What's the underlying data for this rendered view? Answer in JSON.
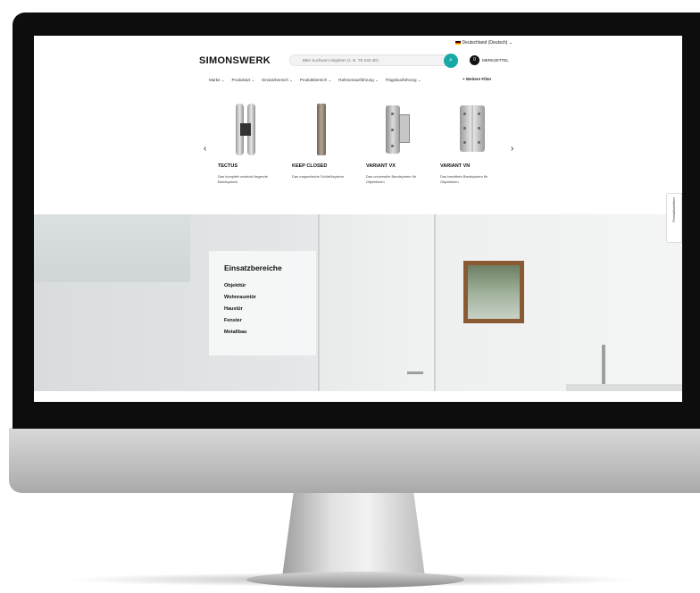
{
  "header": {
    "language": "Deutschland (Deutsch)",
    "logo": "SIMONSWERK",
    "search_placeholder": "Bitte Suchwort eingeben (z. B. TE 540 3D)",
    "merkzettel": "MERKZETTEL",
    "merkzettel_count": "0"
  },
  "nav": {
    "items": [
      "Marke",
      "Produktart",
      "Einsatzbereich",
      "Produktbereich",
      "Rahmenausführung",
      "Flügelausführung"
    ],
    "filter": "Weitere Filter"
  },
  "products": [
    {
      "name": "TECTUS",
      "desc": "Das komplett verdeckt liegende Bandsystem"
    },
    {
      "name": "KEEP CLOSED",
      "desc": "Das magnetische Schließsystem"
    },
    {
      "name": "VARIANT VX",
      "desc": "Das universelle Bandsystem für Objekttüren"
    },
    {
      "name": "VARIANT VN",
      "desc": "Das bewährte Bandsystem für Objekttüren"
    }
  ],
  "side_tab": "Produktselektor",
  "hero": {
    "title": "Einsatzbereiche",
    "links": [
      "Objekttür",
      "Wohnraumtür",
      "Haustür",
      "Fenster",
      "Metallbau"
    ]
  }
}
